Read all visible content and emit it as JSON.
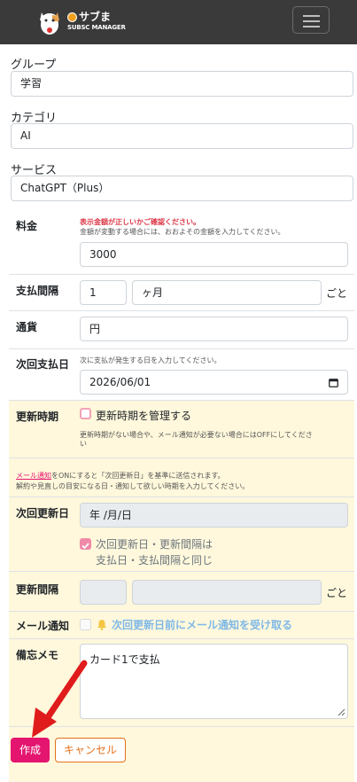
{
  "navbar": {
    "brand_name": "サブま",
    "brand_sub": "SUBSC MANAGER",
    "menu_icon": "hamburger-icon"
  },
  "form": {
    "group": {
      "label": "グループ",
      "value": "学習"
    },
    "category": {
      "label": "カテゴリ",
      "value": "AI"
    },
    "service": {
      "label": "サービス",
      "value": "ChatGPT（Plus）"
    },
    "fee": {
      "label": "料金",
      "warning": "表示金額が正しいかご確認ください。",
      "note": "金額が変動する場合には、おおよその金額を入力してください。",
      "value": "3000"
    },
    "interval": {
      "label": "支払間隔",
      "number": "1",
      "unit": "ヶ月",
      "suffix": "ごと"
    },
    "currency": {
      "label": "通貨",
      "value": "円"
    },
    "next_payment": {
      "label": "次回支払日",
      "note": "次に支払が発生する日を入力してください。",
      "value": "2026/06/01",
      "icon": "calendar-icon"
    },
    "renewal": {
      "label": "更新時期",
      "checkbox_label": "更新時期を管理する",
      "note_line1": "更新時期がない場合や、メール通知が必要ない場合にはOFFにしてくださ",
      "note_line2": "い"
    },
    "renewal_info": {
      "link_text": "メール通知",
      "line1_rest": "をONにすると「次回更新日」を基準に送信されます。",
      "line2": "解約や見直しの目安になる日・通知して欲しい時期を入力してください。"
    },
    "next_renewal": {
      "label": "次回更新日",
      "placeholder": "年 /月/日",
      "same_line1": "次回更新日・更新間隔は",
      "same_line2": "支払日・支払間隔と同じ"
    },
    "renewal_interval": {
      "label": "更新間隔",
      "suffix": "ごと"
    },
    "mail_notify": {
      "label": "メール通知",
      "text": "次回更新日前にメール通知を受け取る",
      "icon": "bell-icon"
    },
    "memo": {
      "label": "備忘メモ",
      "value": "カード1で支払"
    }
  },
  "buttons": {
    "create": "作成",
    "cancel": "キャンセル"
  },
  "colors": {
    "primary": "#e4156f",
    "cancel": "#e4701a",
    "highlight_bg": "#fff8dc",
    "navbar": "#3a3a3a",
    "arrow": "#e01b1b"
  }
}
